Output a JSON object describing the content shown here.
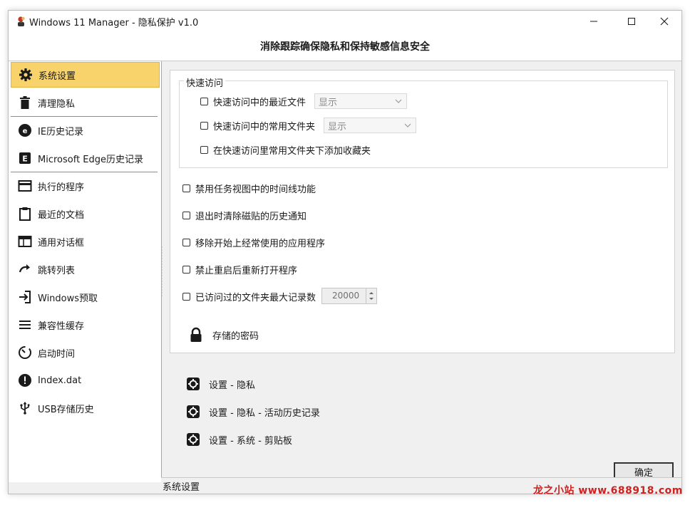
{
  "window": {
    "title": "Windows 11 Manager - 隐私保护 v1.0",
    "banner": "消除跟踪确保隐私和保持敏感信息安全"
  },
  "sidebar": {
    "items": [
      {
        "label": "系统设置",
        "icon": "gear-icon",
        "active": true
      },
      {
        "label": "清理隐私",
        "icon": "trash-icon"
      },
      {
        "label": "IE历史记录",
        "icon": "ie-icon"
      },
      {
        "label": "Microsoft  Edge历史记录",
        "icon": "edge-icon"
      },
      {
        "label": "执行的程序",
        "icon": "window-icon"
      },
      {
        "label": "最近的文档",
        "icon": "clipboard-icon"
      },
      {
        "label": "通用对话框",
        "icon": "dialog-icon"
      },
      {
        "label": "跳转列表",
        "icon": "redo-arrow-icon"
      },
      {
        "label": "Windows预取",
        "icon": "login-arrow-icon"
      },
      {
        "label": "兼容性缓存",
        "icon": "lines-icon"
      },
      {
        "label": "启动时间",
        "icon": "timer-icon"
      },
      {
        "label": "Index.dat",
        "icon": "exclamation-icon"
      },
      {
        "label": "USB存储历史",
        "icon": "usb-icon"
      }
    ]
  },
  "quick_access": {
    "title": "快速访问",
    "recent_files": {
      "label": "快速访问中的最近文件",
      "value": "显示",
      "checked": false
    },
    "frequent_folders": {
      "label": "快速访问中的常用文件夹",
      "value": "显示",
      "checked": false
    },
    "add_favorites": {
      "label": "在快速访问里常用文件夹下添加收藏夹",
      "checked": false
    }
  },
  "options": [
    {
      "label": "禁用任务视图中的时间线功能",
      "checked": false
    },
    {
      "label": "退出时清除磁贴的历史通知",
      "checked": false
    },
    {
      "label": "移除开始上经常使用的应用程序",
      "checked": false
    },
    {
      "label": "禁止重启后重新打开程序",
      "checked": false
    },
    {
      "label": "已访问过的文件夹最大记录数",
      "checked": false,
      "value": "20000"
    }
  ],
  "stored_password": "存储的密码",
  "links": [
    "设置 - 隐私",
    "设置 - 隐私 - 活动历史记录",
    "设置 - 系统 - 剪贴板"
  ],
  "ok_button": "确定",
  "status": "系统设置",
  "watermark": "龙之小站 www.688918.com",
  "colors": {
    "active_item": "#f8d26a",
    "active_border": "#e3b440",
    "watermark": "#d02020"
  }
}
